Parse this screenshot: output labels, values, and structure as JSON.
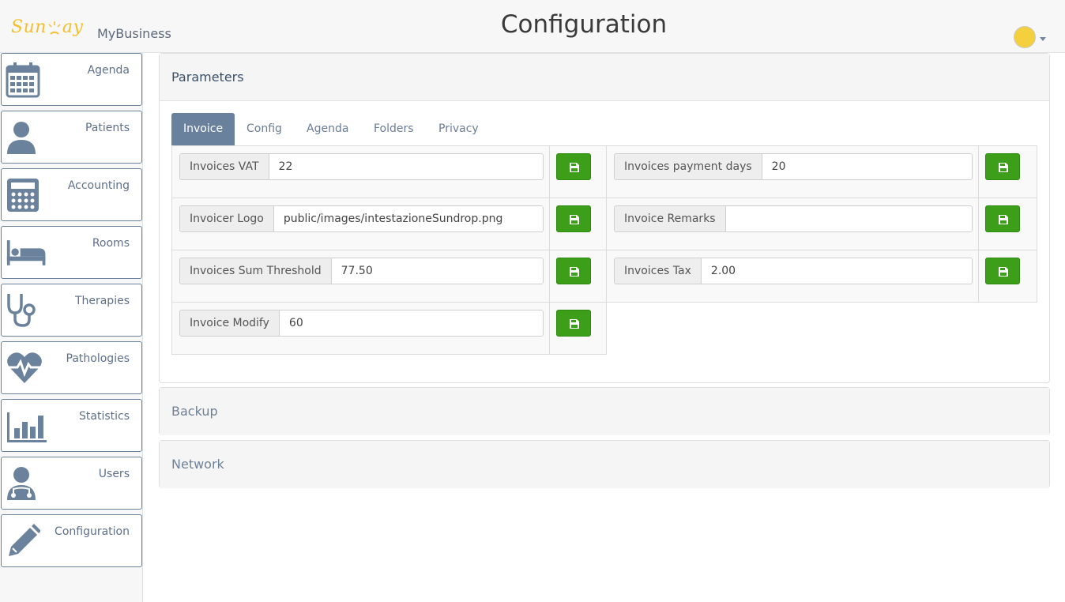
{
  "header": {
    "logo_text": "SunDay",
    "brand": "MyBusiness",
    "title": "Configuration",
    "avatar_color": "#f4d03f"
  },
  "sidebar": {
    "items": [
      {
        "label": "Agenda",
        "icon": "calendar-icon"
      },
      {
        "label": "Patients",
        "icon": "user-icon"
      },
      {
        "label": "Accounting",
        "icon": "calculator-icon"
      },
      {
        "label": "Rooms",
        "icon": "bed-icon"
      },
      {
        "label": "Therapies",
        "icon": "stethoscope-icon"
      },
      {
        "label": "Pathologies",
        "icon": "heartbeat-icon"
      },
      {
        "label": "Statistics",
        "icon": "bar-chart-icon"
      },
      {
        "label": "Users",
        "icon": "doctor-icon"
      },
      {
        "label": "Configuration",
        "icon": "pencil-icon"
      }
    ]
  },
  "parameters": {
    "title": "Parameters",
    "tabs": [
      "Invoice",
      "Config",
      "Agenda",
      "Folders",
      "Privacy"
    ],
    "active_tab": "Invoice",
    "fields": [
      {
        "label": "Invoices VAT",
        "value": "22"
      },
      {
        "label": "Invoices payment days",
        "value": "20"
      },
      {
        "label": "Invoicer Logo",
        "value": "public/images/intestazioneSundrop.png"
      },
      {
        "label": "Invoice Remarks",
        "value": ""
      },
      {
        "label": "Invoices Sum Threshold",
        "value": "77.50"
      },
      {
        "label": "Invoices Tax",
        "value": "2.00"
      },
      {
        "label": "Invoice Modify",
        "value": "60"
      }
    ],
    "save_icon": "floppy-disk-icon",
    "save_color": "#3c9e19"
  },
  "backup": {
    "title": "Backup"
  },
  "network": {
    "title": "Network"
  }
}
